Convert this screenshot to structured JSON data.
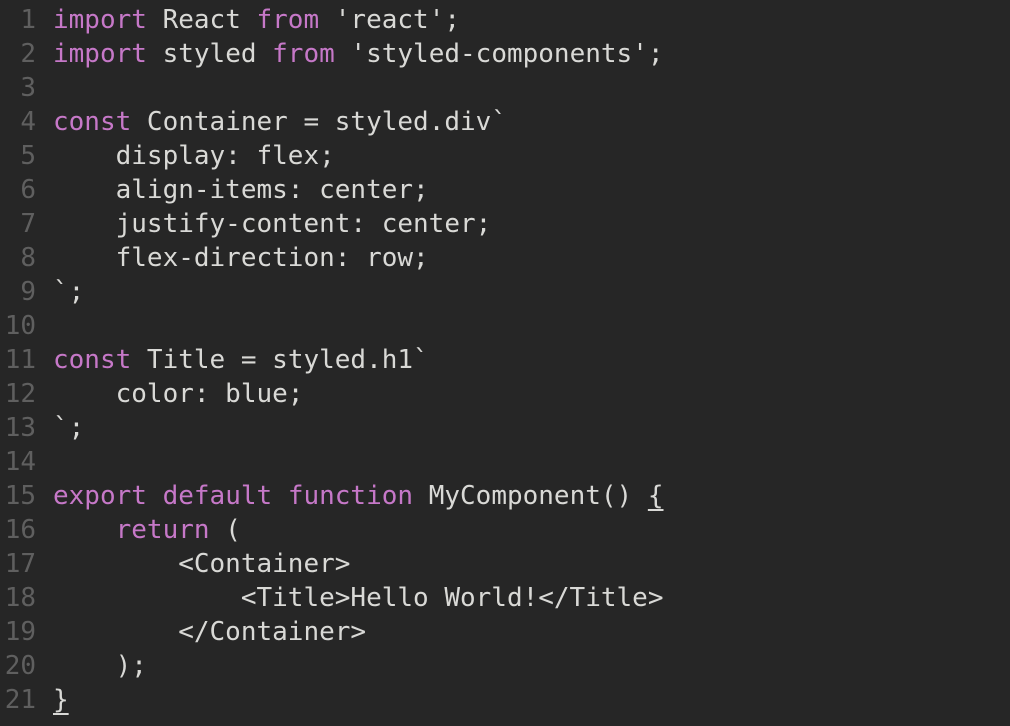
{
  "editor": {
    "theme_colors": {
      "background": "#262626",
      "text": "#d9d9d6",
      "keyword": "#c678c8",
      "line_number": "#5f5f5f"
    },
    "lines": [
      {
        "number": "1",
        "tokens": [
          {
            "t": "import",
            "k": "kw"
          },
          {
            "t": " React ",
            "k": "id"
          },
          {
            "t": "from",
            "k": "kw"
          },
          {
            "t": " 'react';",
            "k": "id"
          }
        ]
      },
      {
        "number": "2",
        "tokens": [
          {
            "t": "import",
            "k": "kw"
          },
          {
            "t": " styled ",
            "k": "id"
          },
          {
            "t": "from",
            "k": "kw"
          },
          {
            "t": " 'styled-components';",
            "k": "id"
          }
        ]
      },
      {
        "number": "3",
        "tokens": []
      },
      {
        "number": "4",
        "tokens": [
          {
            "t": "const",
            "k": "kw"
          },
          {
            "t": " Container = styled.div`",
            "k": "id"
          }
        ]
      },
      {
        "number": "5",
        "tokens": [
          {
            "t": "    display: flex;",
            "k": "id"
          }
        ]
      },
      {
        "number": "6",
        "tokens": [
          {
            "t": "    align-items: center;",
            "k": "id"
          }
        ]
      },
      {
        "number": "7",
        "tokens": [
          {
            "t": "    justify-content: center;",
            "k": "id"
          }
        ]
      },
      {
        "number": "8",
        "tokens": [
          {
            "t": "    flex-direction: row;",
            "k": "id"
          }
        ]
      },
      {
        "number": "9",
        "tokens": [
          {
            "t": "`;",
            "k": "id"
          }
        ]
      },
      {
        "number": "10",
        "tokens": []
      },
      {
        "number": "11",
        "tokens": [
          {
            "t": "const",
            "k": "kw"
          },
          {
            "t": " Title = styled.h1`",
            "k": "id"
          }
        ]
      },
      {
        "number": "12",
        "tokens": [
          {
            "t": "    color: blue;",
            "k": "id"
          }
        ]
      },
      {
        "number": "13",
        "tokens": [
          {
            "t": "`;",
            "k": "id"
          }
        ]
      },
      {
        "number": "14",
        "tokens": []
      },
      {
        "number": "15",
        "tokens": [
          {
            "t": "export",
            "k": "kw"
          },
          {
            "t": " ",
            "k": "id"
          },
          {
            "t": "default",
            "k": "kw"
          },
          {
            "t": " ",
            "k": "id"
          },
          {
            "t": "function",
            "k": "kw"
          },
          {
            "t": " MyComponent() ",
            "k": "id"
          },
          {
            "t": "{",
            "k": "id",
            "u": true
          }
        ]
      },
      {
        "number": "16",
        "tokens": [
          {
            "t": "    ",
            "k": "id"
          },
          {
            "t": "return",
            "k": "kw"
          },
          {
            "t": " (",
            "k": "id"
          }
        ]
      },
      {
        "number": "17",
        "tokens": [
          {
            "t": "        <Container>",
            "k": "id"
          }
        ]
      },
      {
        "number": "18",
        "tokens": [
          {
            "t": "            <Title>Hello World!</Title>",
            "k": "id"
          }
        ]
      },
      {
        "number": "19",
        "tokens": [
          {
            "t": "        </Container>",
            "k": "id"
          }
        ]
      },
      {
        "number": "20",
        "tokens": [
          {
            "t": "    );",
            "k": "id"
          }
        ]
      },
      {
        "number": "21",
        "tokens": [
          {
            "t": "}",
            "k": "id",
            "u": true
          }
        ]
      }
    ]
  }
}
